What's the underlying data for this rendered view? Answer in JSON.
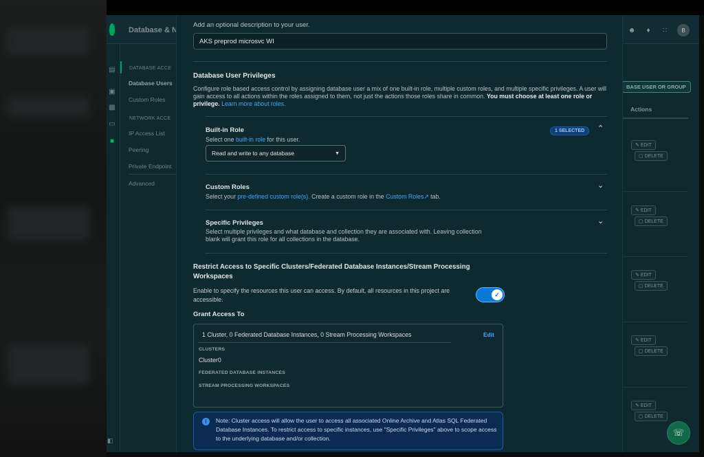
{
  "app": {
    "title": "Database & N",
    "avatar_initial": "B"
  },
  "sidebar": {
    "groups": [
      "DATABASE ACCE",
      "NETWORK ACCE"
    ],
    "items": [
      "Database Users",
      "Custom Roles",
      "IP Access List",
      "Peering",
      "Private Endpoint",
      "Advanced"
    ]
  },
  "background_table": {
    "add_button": "BASE USER OR GROUP",
    "actions_header": "Actions",
    "edit_label": "EDIT",
    "delete_label": "DELETE"
  },
  "modal": {
    "description_label": "Add an optional description to your user.",
    "description_value": "AKS preprod microsvc WI",
    "privileges": {
      "title": "Database User Privileges",
      "text": "Configure role based access control by assigning database user a mix of one built-in role, multiple custom roles, and multiple specific privileges. A user will gain access to all actions within the roles assigned to them, not just the actions those roles share in common.",
      "bold_text": "You must choose at least one role or privilege.",
      "link": "Learn more about roles."
    },
    "builtin_role": {
      "title": "Built-in Role",
      "sub_prefix": "Select one ",
      "sub_link": "built-in role",
      "sub_suffix": " for this user.",
      "badge": "1 SELECTED",
      "selected": "Read and write to any database"
    },
    "custom_roles": {
      "title": "Custom Roles",
      "sub_prefix": "Select your ",
      "sub_link": "pre-defined custom role(s).",
      "sub_mid": " Create a custom role in the ",
      "sub_link2": "Custom Roles",
      "sub_suffix": " tab."
    },
    "specific_privileges": {
      "title": "Specific Privileges",
      "sub": "Select multiple privileges and what database and collection they are associated with. Leaving collection blank will grant this role for all collections in the database."
    },
    "restrict": {
      "title": "Restrict Access to Specific Clusters/Federated Database Instances/Stream Processing Workspaces",
      "text": "Enable to specify the resources this user can access. By default, all resources in this project are accessible.",
      "enabled": true
    },
    "grant": {
      "title": "Grant Access To",
      "summary": "1 Cluster, 0 Federated Database Instances, 0 Stream Processing Workspaces",
      "edit": "Edit",
      "clusters_label": "CLUSTERS",
      "clusters": [
        "Cluster0"
      ],
      "federated_label": "FEDERATED DATABASE INSTANCES",
      "stream_label": "STREAM PROCESSING WORKSPACES"
    },
    "note": "Note: Cluster access will allow the user to access all associated Online Archive and Atlas SQL Federated Database Instances. To restrict access to specific instances, use \"Specific Privileges\" above to scope access to the underlying database and/or collection."
  }
}
